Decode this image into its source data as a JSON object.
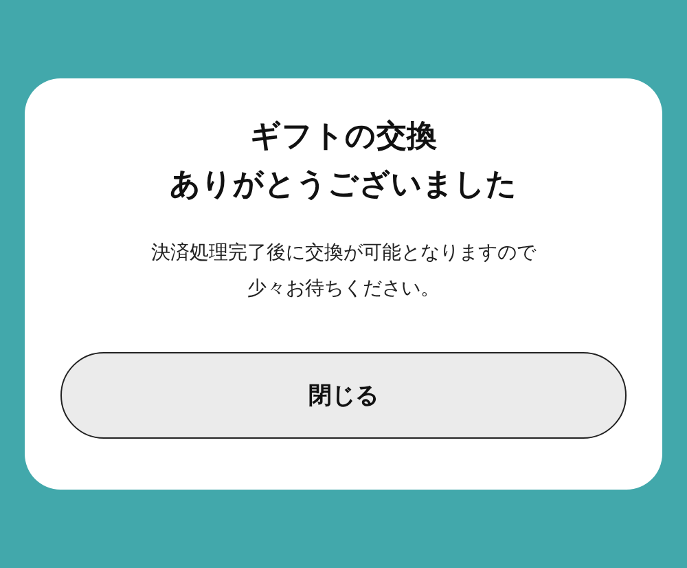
{
  "dialog": {
    "title_lines": [
      "ギフトの交換",
      "ありがとうございました"
    ],
    "message_lines": [
      "決済処理完了後に交換が可能となりますので",
      "少々お待ちください。"
    ],
    "button": "閉じる"
  }
}
